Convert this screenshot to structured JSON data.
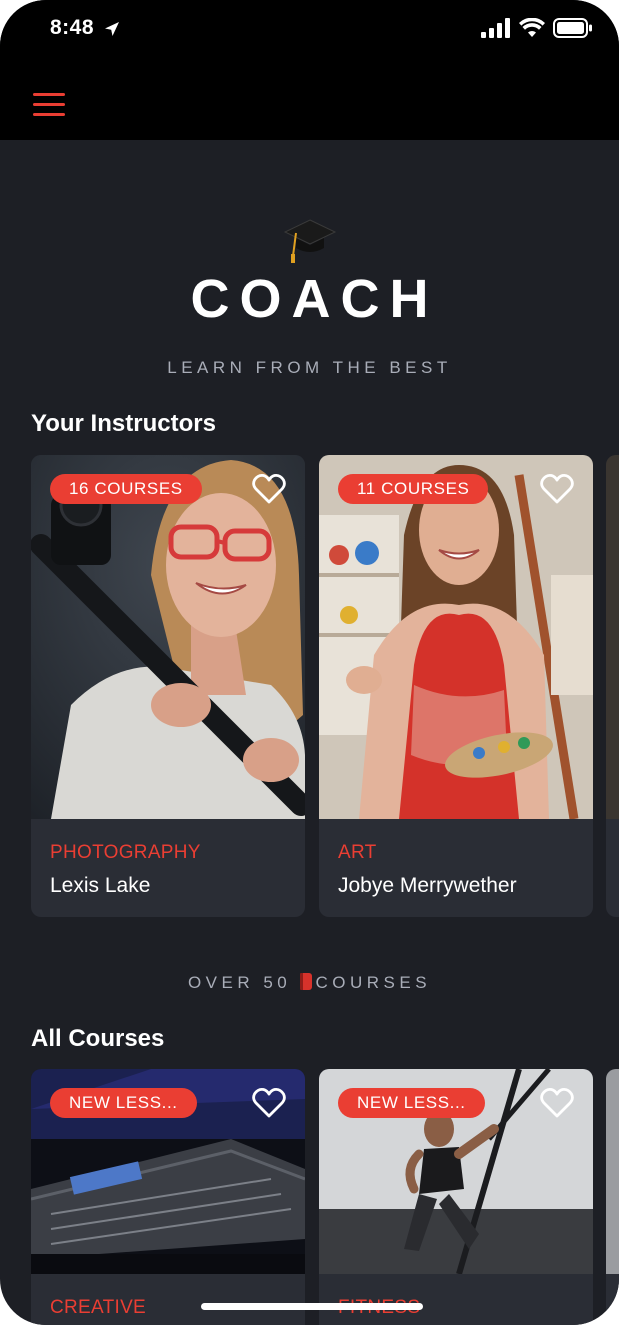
{
  "status_bar": {
    "time": "8:48"
  },
  "header": {
    "menu_icon": "hamburger-menu-icon",
    "accent_color": "#ea3e33"
  },
  "hero": {
    "logo_icon": "graduation-cap-icon",
    "brand": "COACH",
    "tagline": "LEARN FROM THE BEST"
  },
  "instructors": {
    "title": "Your Instructors",
    "cards": [
      {
        "badge": "16 COURSES",
        "category": "PHOTOGRAPHY",
        "name": "Lexis Lake"
      },
      {
        "badge": "11 COURSES",
        "category": "ART",
        "name": "Jobye Merrywether"
      }
    ]
  },
  "courses_count": {
    "text_before": "OVER 50",
    "icon": "book-icon",
    "text_after": "COURSES"
  },
  "all_courses": {
    "title": "All Courses",
    "cards": [
      {
        "badge": "NEW LESS...",
        "category": "CREATIVE"
      },
      {
        "badge": "NEW LESS...",
        "category": "FITNESS"
      }
    ]
  }
}
